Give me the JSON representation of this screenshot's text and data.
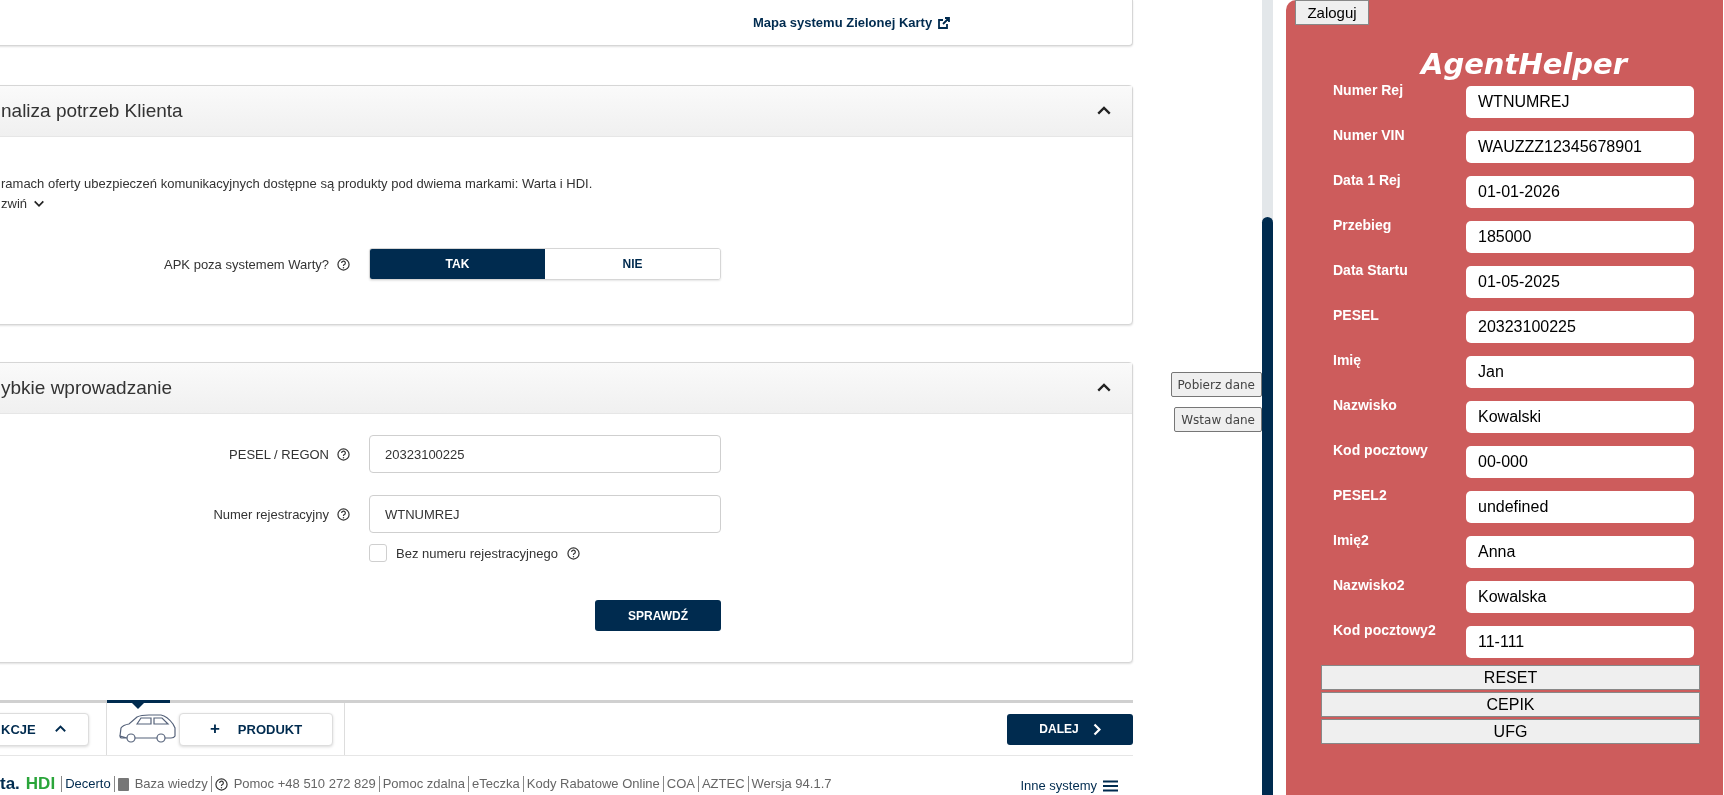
{
  "top_card": {
    "link": "Mapa systemu Zielonej Karty"
  },
  "needs_section": {
    "title": "naliza potrzeb Klienta",
    "expanded": true,
    "description": "ramach oferty ubezpieczeń komunikacyjnych dostępne są produkty pod dwiema markami: Warta i HDI.",
    "toggle_link": "zwiń",
    "question": {
      "label": "APK poza systemem Warty?",
      "options": [
        {
          "label": "TAK",
          "selected": true
        },
        {
          "label": "NIE",
          "selected": false
        }
      ]
    }
  },
  "quick_entry": {
    "title": "ybkie wprowadzanie",
    "expanded": true,
    "fields": [
      {
        "label": "PESEL / REGON",
        "value": "20323100225"
      },
      {
        "label": "Numer rejestracyjny",
        "value": "WTNUMREJ"
      }
    ],
    "checkbox": {
      "label": "Bez numeru rejestracyjnego",
      "checked": false
    },
    "submit": "SPRAWDŹ"
  },
  "bottom_bar": {
    "sections_button": "KCJE",
    "add_product_plus": "+",
    "add_product": "PRODUKT",
    "next": "DALEJ"
  },
  "footer": {
    "logo_left": "ta.",
    "logo_right": "HDI",
    "links": [
      "Decerto",
      "Baza wiedzy",
      "Pomoc +48 510 272 829",
      "Pomoc zdalna",
      "eTeczka",
      "Kody Rabatowe Online",
      "COA",
      "AZTEC",
      "Wersja 94.1.7"
    ],
    "other_systems": "Inne systemy"
  },
  "side_buttons": [
    "Pobierz dane",
    "Wstaw dane"
  ],
  "agent_helper": {
    "login": "Zaloguj",
    "title": "AgentHelper",
    "fields": [
      {
        "label": "Numer Rej",
        "value": "WTNUMREJ"
      },
      {
        "label": "Numer VIN",
        "value": "WAUZZZ12345678901"
      },
      {
        "label": "Data 1 Rej",
        "value": "01-01-2026"
      },
      {
        "label": "Przebieg",
        "value": "185000"
      },
      {
        "label": "Data Startu",
        "value": "01-05-2025"
      },
      {
        "label": "PESEL",
        "value": "20323100225"
      },
      {
        "label": "Imię",
        "value": "Jan"
      },
      {
        "label": "Nazwisko",
        "value": "Kowalski"
      },
      {
        "label": "Kod pocztowy",
        "value": "00-000"
      },
      {
        "label": "PESEL2",
        "value": "undefined"
      },
      {
        "label": "Imię2",
        "value": "Anna"
      },
      {
        "label": "Nazwisko2",
        "value": "Kowalska"
      },
      {
        "label": "Kod pocztowy2",
        "value": "11-111"
      }
    ],
    "buttons": [
      "RESET",
      "CEPIK",
      "UFG"
    ]
  }
}
